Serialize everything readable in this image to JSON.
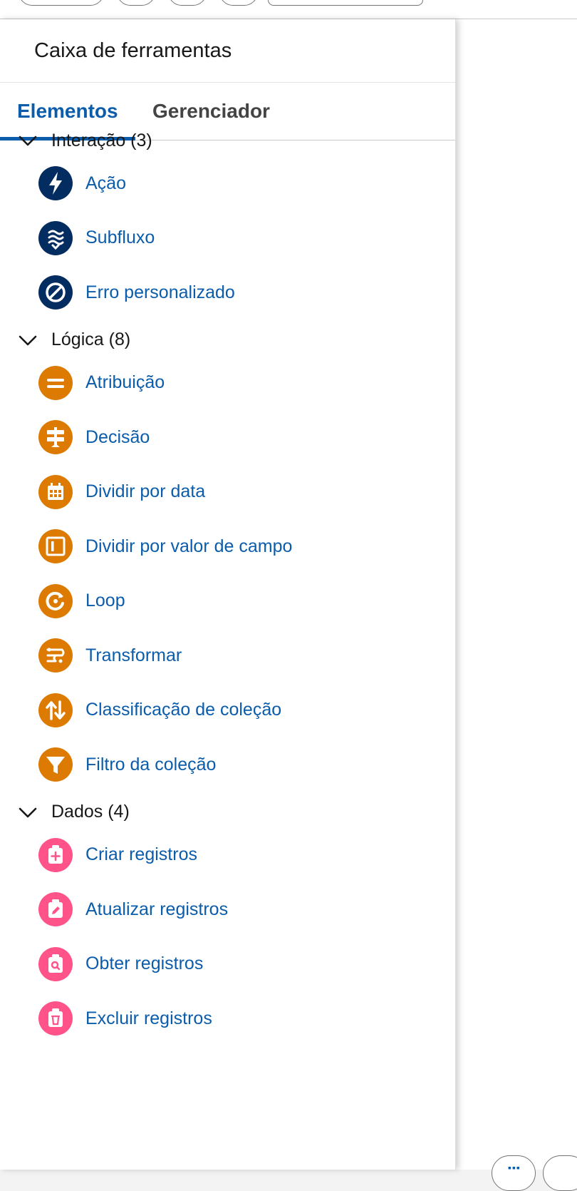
{
  "panel": {
    "title": "Caixa de ferramentas"
  },
  "tabs": [
    {
      "label": "Elementos",
      "active": true
    },
    {
      "label": "Gerenciador",
      "active": false
    }
  ],
  "sections": [
    {
      "label": "Interação (3)",
      "color": "#032d60",
      "items": [
        {
          "label": "Ação",
          "icon": "lightning-icon"
        },
        {
          "label": "Subfluxo",
          "icon": "subflow-icon"
        },
        {
          "label": "Erro personalizado",
          "icon": "ban-icon"
        }
      ]
    },
    {
      "label": "Lógica (8)",
      "color": "#dd7a01",
      "items": [
        {
          "label": "Atribuição",
          "icon": "equals-icon"
        },
        {
          "label": "Decisão",
          "icon": "decision-icon"
        },
        {
          "label": "Dividir por data",
          "icon": "calendar-icon"
        },
        {
          "label": "Dividir por valor de campo",
          "icon": "field-value-icon"
        },
        {
          "label": "Loop",
          "icon": "loop-icon"
        },
        {
          "label": "Transformar",
          "icon": "transform-icon"
        },
        {
          "label": "Classificação de coleção",
          "icon": "sort-icon"
        },
        {
          "label": "Filtro da coleção",
          "icon": "filter-icon"
        }
      ]
    },
    {
      "label": "Dados (4)",
      "color": "#ff538a",
      "items": [
        {
          "label": "Criar registros",
          "icon": "record-create-icon"
        },
        {
          "label": "Atualizar registros",
          "icon": "record-update-icon"
        },
        {
          "label": "Obter registros",
          "icon": "record-lookup-icon"
        },
        {
          "label": "Excluir registros",
          "icon": "record-delete-icon"
        }
      ]
    }
  ],
  "colors": {
    "accent": "#0b5cab",
    "text": "#181818"
  }
}
